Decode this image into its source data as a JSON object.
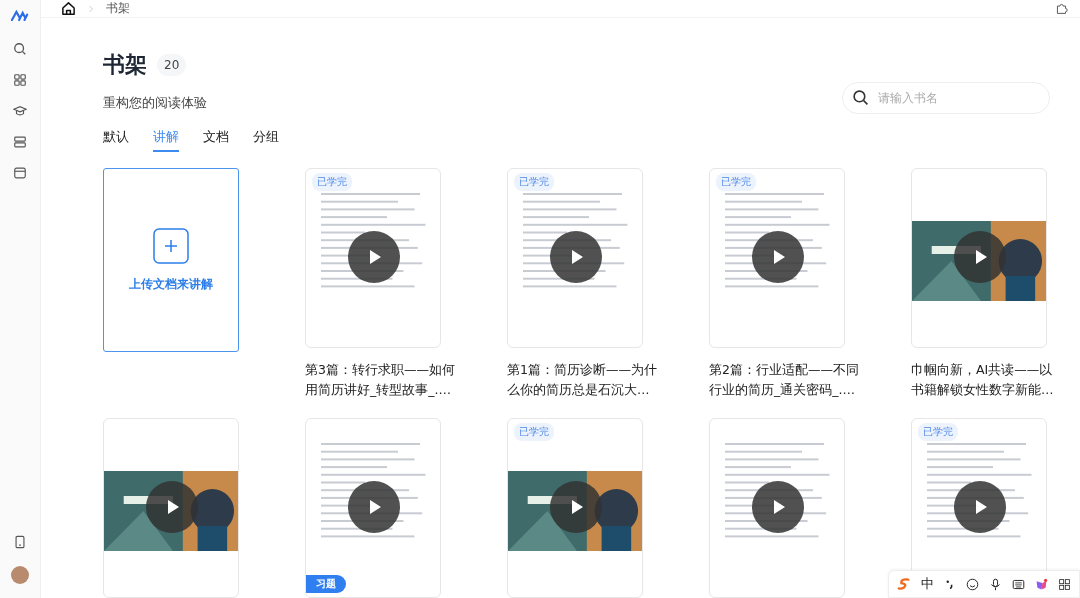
{
  "breadcrumb": [
    "书架"
  ],
  "header": {
    "title": "书架",
    "count": "20",
    "subtitle": "重构您的阅读体验"
  },
  "search": {
    "placeholder": "请输入书名"
  },
  "tabs": [
    {
      "label": "默认",
      "selected": false
    },
    {
      "label": "讲解",
      "selected": true
    },
    {
      "label": "文档",
      "selected": false
    },
    {
      "label": "分组",
      "selected": false
    }
  ],
  "upload": {
    "label": "上传文档来讲解"
  },
  "cards": [
    {
      "kind": "document",
      "badge": {
        "kind": "done",
        "label": "已学完"
      },
      "title": "第3篇：转行求职——如何用简历讲好_转型故事_.…"
    },
    {
      "kind": "document",
      "badge": {
        "kind": "done",
        "label": "已学完"
      },
      "title": "第1篇：简历诊断——为什么你的简历总是石沉大…"
    },
    {
      "kind": "document",
      "badge": {
        "kind": "done",
        "label": "已学完"
      },
      "title": "第2篇：行业适配——不同行业的简历_通关密码_.…"
    },
    {
      "kind": "picture",
      "title": "巾帼向新，AI共读——以书籍解锁女性数字新能…"
    },
    {
      "kind": "picture"
    },
    {
      "kind": "document",
      "badge": {
        "kind": "exercise",
        "label": "习题"
      }
    },
    {
      "kind": "picture",
      "badge": {
        "kind": "done",
        "label": "已学完"
      }
    },
    {
      "kind": "document"
    },
    {
      "kind": "document",
      "badge": {
        "kind": "done",
        "label": "已学完"
      }
    }
  ],
  "ime_bar": {
    "mode": "中"
  }
}
